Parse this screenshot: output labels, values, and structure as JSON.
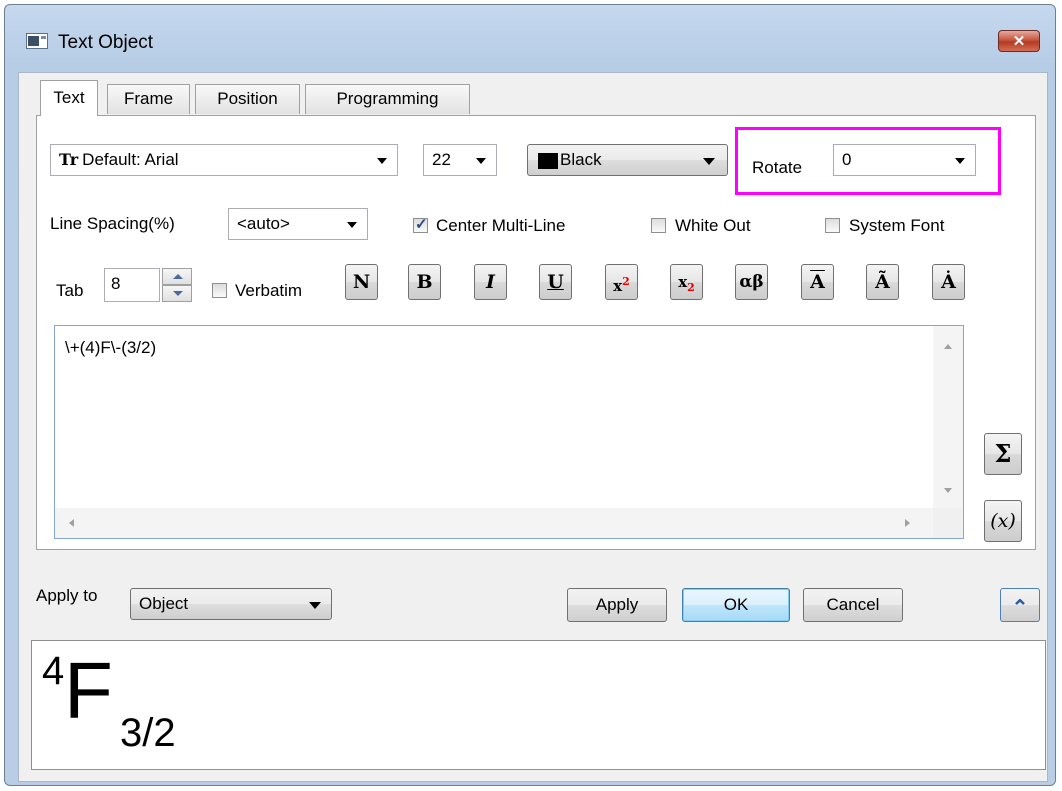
{
  "window": {
    "title": "Text Object",
    "close_symbol": "✕"
  },
  "tabs": [
    {
      "label": "Text",
      "active": true
    },
    {
      "label": "Frame",
      "active": false
    },
    {
      "label": "Position",
      "active": false
    },
    {
      "label": "Programming",
      "active": false
    }
  ],
  "font": {
    "icon_glyph": "Tr",
    "value": "Default: Arial"
  },
  "font_size": {
    "value": "22"
  },
  "color": {
    "value": "Black",
    "swatch": "#000000"
  },
  "rotate": {
    "label": "Rotate",
    "value": "0",
    "highlight_color": "#ff00ff"
  },
  "line_spacing": {
    "label": "Line Spacing(%)",
    "value": "<auto>"
  },
  "options": {
    "center_multiline": {
      "label": "Center Multi-Line",
      "checked": true
    },
    "white_out": {
      "label": "White Out",
      "checked": false
    },
    "system_font": {
      "label": "System Font",
      "checked": false
    },
    "verbatim": {
      "label": "Verbatim",
      "checked": false
    }
  },
  "tab_setting": {
    "label": "Tab",
    "value": "8"
  },
  "format_buttons": {
    "normal": "N",
    "bold": "B",
    "italic": "I",
    "underline": "U",
    "superscript_base": "x",
    "superscript_exp": "2",
    "subscript_base": "x",
    "subscript_idx": "2",
    "greek": "αβ",
    "overbar": "A",
    "tilde": "Ã",
    "dot": "Ȧ",
    "script_color": "#e00000"
  },
  "editor": {
    "text": "\\+(4)F\\-(3/2)"
  },
  "side_buttons": {
    "sigma": "Σ",
    "variable": "(x)"
  },
  "apply_to": {
    "label": "Apply to",
    "value": "Object"
  },
  "actions": {
    "apply": "Apply",
    "ok": "OK",
    "cancel": "Cancel",
    "expand_symbol": "⌃"
  },
  "preview": {
    "base": "F",
    "superscript": "4",
    "subscript": "3/2"
  }
}
